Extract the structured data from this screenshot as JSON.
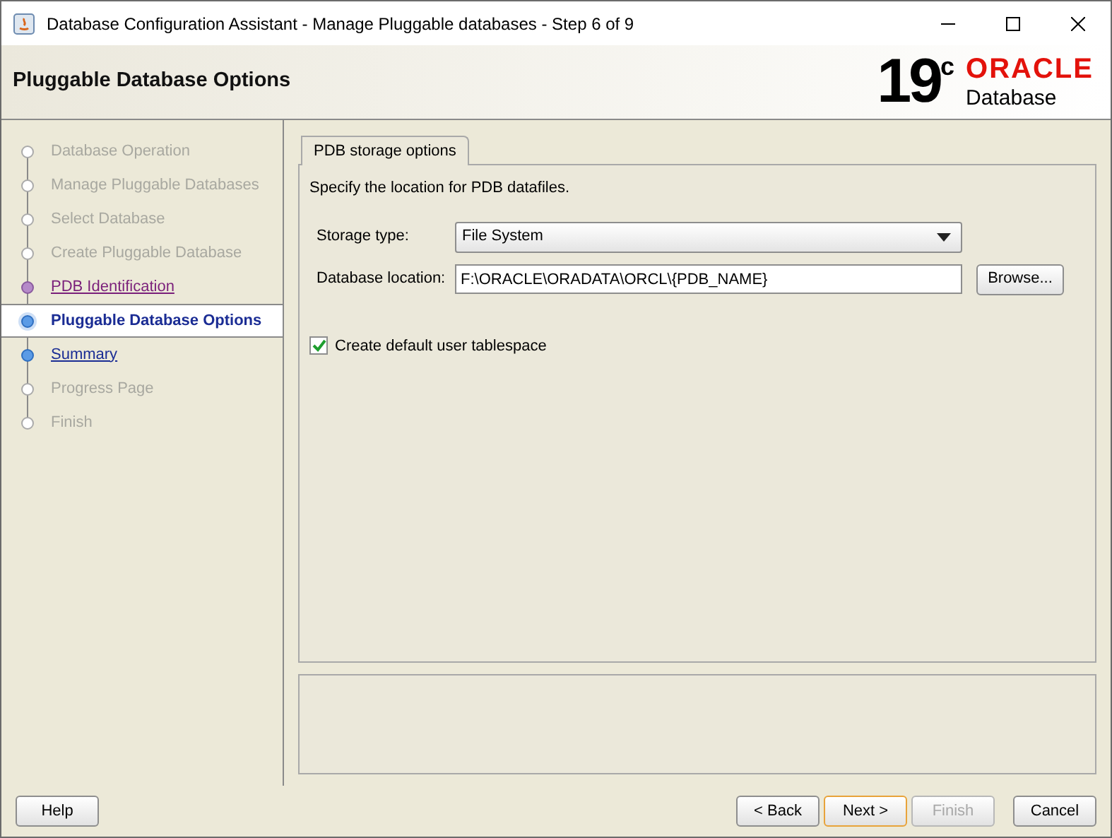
{
  "window": {
    "title": "Database Configuration Assistant - Manage Pluggable databases - Step 6 of 9"
  },
  "header": {
    "title": "Pluggable Database Options",
    "logo": {
      "version": "19",
      "version_suffix": "c",
      "brand": "ORACLE",
      "product": "Database"
    }
  },
  "steps": [
    {
      "label": "Database Operation",
      "disabled": true,
      "visited": false,
      "selected": false
    },
    {
      "label": "Manage Pluggable Databases",
      "disabled": true,
      "visited": false,
      "selected": false
    },
    {
      "label": "Select Database",
      "disabled": true,
      "visited": false,
      "selected": false
    },
    {
      "label": "Create Pluggable Database",
      "disabled": true,
      "visited": false,
      "selected": false
    },
    {
      "label": "PDB Identification",
      "disabled": false,
      "visited": true,
      "selected": false
    },
    {
      "label": "Pluggable Database Options",
      "disabled": false,
      "visited": false,
      "selected": true
    },
    {
      "label": "Summary",
      "disabled": false,
      "visited": false,
      "selected": false
    },
    {
      "label": "Progress Page",
      "disabled": true,
      "visited": false,
      "selected": false
    },
    {
      "label": "Finish",
      "disabled": true,
      "visited": false,
      "selected": false
    }
  ],
  "tabs": [
    {
      "label": "PDB storage options",
      "selected": true
    }
  ],
  "panel": {
    "instruction": "Specify the location for PDB datafiles.",
    "storage_type": {
      "label": "Storage type:",
      "value": "File System"
    },
    "database_location": {
      "label": "Database location:",
      "value": "F:\\ORACLE\\ORADATA\\ORCL\\{PDB_NAME}",
      "button": "Browse..."
    },
    "default_tablespace": {
      "label": "Create default user tablespace",
      "checked": true
    }
  },
  "buttons": [
    {
      "label": "Help",
      "disabled": false,
      "focused": false
    },
    {
      "label": "< Back",
      "disabled": false,
      "focused": false
    },
    {
      "label": "Next >",
      "disabled": false,
      "focused": true
    },
    {
      "label": "Finish",
      "disabled": true,
      "focused": false
    },
    {
      "label": "Cancel",
      "disabled": false,
      "focused": false
    }
  ]
}
